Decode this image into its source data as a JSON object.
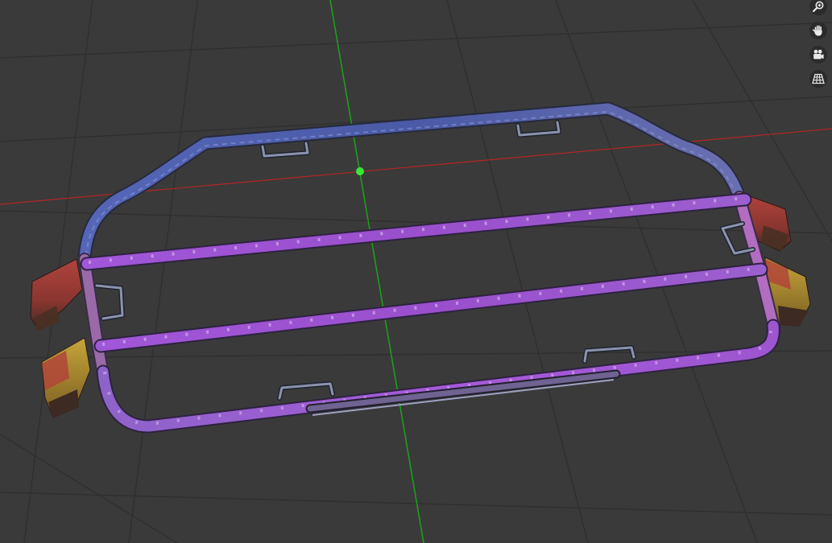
{
  "viewport": {
    "background_color": "#3a3a3a",
    "grid_color": "#2f2f2f",
    "x_axis_color": "#b52424",
    "y_axis_color": "#19a019",
    "origin_color": "#35e835"
  },
  "model": {
    "outer_frame_color": "#4b5fae",
    "rail_color": "#9b50c8",
    "bracket_color": "#a0403a",
    "bracket_accent_color": "#b8962c",
    "handle_color": "#7f86a4"
  },
  "navigation": {
    "buttons": [
      {
        "icon": "zoom-icon"
      },
      {
        "icon": "pan-hand-icon"
      },
      {
        "icon": "camera-icon"
      },
      {
        "icon": "perspective-grid-icon"
      }
    ],
    "icon_color": "#e8e8e8"
  }
}
